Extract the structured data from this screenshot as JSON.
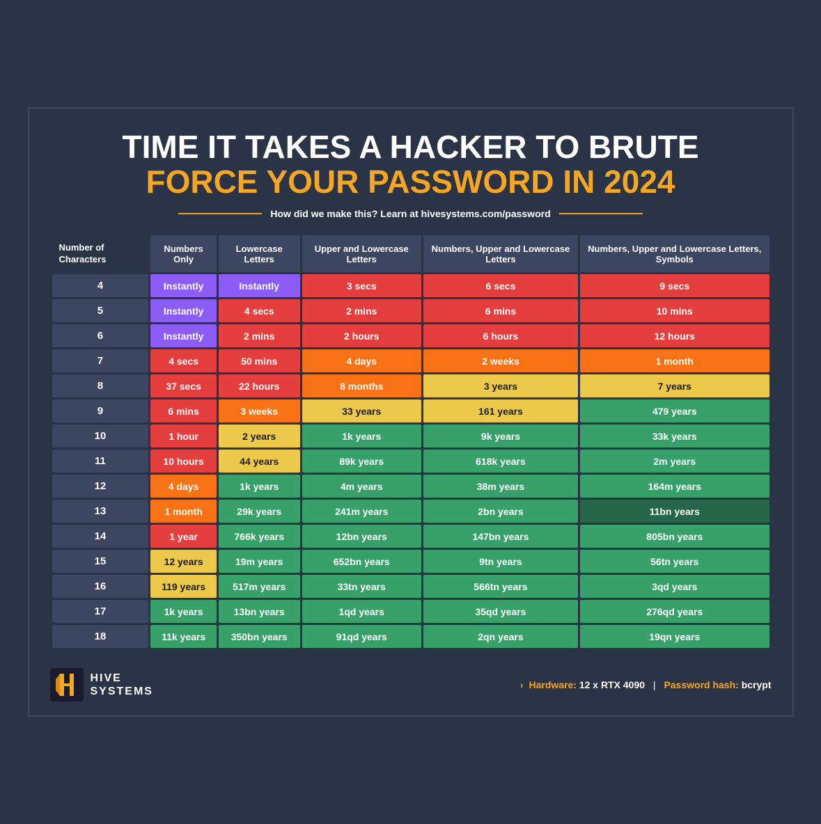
{
  "title": {
    "line1": "TIME IT TAKES A HACKER TO BRUTE",
    "line2": "FORCE YOUR PASSWORD IN ",
    "year": "2024"
  },
  "subtitle": "How did we make this? Learn at hivesystems.com/password",
  "headers": {
    "col0": "Number of Characters",
    "col1": "Numbers Only",
    "col2": "Lowercase Letters",
    "col3": "Upper and Lowercase Letters",
    "col4": "Numbers, Upper and Lowercase Letters",
    "col5": "Numbers, Upper and Lowercase Letters, Symbols"
  },
  "rows": [
    {
      "chars": "4",
      "c1": "Instantly",
      "c2": "Instantly",
      "c3": "3 secs",
      "c4": "6 secs",
      "c5": "9 secs",
      "cl1": "instantly",
      "cl2": "instantly",
      "cl3": "red",
      "cl4": "red",
      "cl5": "red"
    },
    {
      "chars": "5",
      "c1": "Instantly",
      "c2": "4 secs",
      "c3": "2 mins",
      "c4": "6 mins",
      "c5": "10 mins",
      "cl1": "instantly",
      "cl2": "red",
      "cl3": "red",
      "cl4": "red",
      "cl5": "red"
    },
    {
      "chars": "6",
      "c1": "Instantly",
      "c2": "2 mins",
      "c3": "2 hours",
      "c4": "6 hours",
      "c5": "12 hours",
      "cl1": "instantly",
      "cl2": "red",
      "cl3": "red",
      "cl4": "red",
      "cl5": "red"
    },
    {
      "chars": "7",
      "c1": "4 secs",
      "c2": "50 mins",
      "c3": "4 days",
      "c4": "2 weeks",
      "c5": "1 month",
      "cl1": "red",
      "cl2": "red",
      "cl3": "orange",
      "cl4": "orange",
      "cl5": "orange"
    },
    {
      "chars": "8",
      "c1": "37 secs",
      "c2": "22 hours",
      "c3": "8 months",
      "c4": "3 years",
      "c5": "7 years",
      "cl1": "red",
      "cl2": "red",
      "cl3": "orange",
      "cl4": "yellow",
      "cl5": "yellow"
    },
    {
      "chars": "9",
      "c1": "6 mins",
      "c2": "3 weeks",
      "c3": "33 years",
      "c4": "161 years",
      "c5": "479 years",
      "cl1": "red",
      "cl2": "orange",
      "cl3": "yellow",
      "cl4": "yellow",
      "cl5": "green"
    },
    {
      "chars": "10",
      "c1": "1 hour",
      "c2": "2 years",
      "c3": "1k years",
      "c4": "9k years",
      "c5": "33k years",
      "cl1": "red",
      "cl2": "yellow",
      "cl3": "green",
      "cl4": "green",
      "cl5": "green"
    },
    {
      "chars": "11",
      "c1": "10 hours",
      "c2": "44 years",
      "c3": "89k years",
      "c4": "618k years",
      "c5": "2m years",
      "cl1": "red",
      "cl2": "yellow",
      "cl3": "green",
      "cl4": "green",
      "cl5": "green"
    },
    {
      "chars": "12",
      "c1": "4 days",
      "c2": "1k years",
      "c3": "4m years",
      "c4": "38m years",
      "c5": "164m years",
      "cl1": "orange",
      "cl2": "green",
      "cl3": "green",
      "cl4": "green",
      "cl5": "green"
    },
    {
      "chars": "13",
      "c1": "1 month",
      "c2": "29k years",
      "c3": "241m years",
      "c4": "2bn years",
      "c5": "11bn years",
      "cl1": "orange",
      "cl2": "green",
      "cl3": "green",
      "cl4": "green",
      "cl5": "dark-green"
    },
    {
      "chars": "14",
      "c1": "1 year",
      "c2": "766k years",
      "c3": "12bn years",
      "c4": "147bn years",
      "c5": "805bn years",
      "cl1": "red",
      "cl2": "green",
      "cl3": "green",
      "cl4": "green",
      "cl5": "green"
    },
    {
      "chars": "15",
      "c1": "12 years",
      "c2": "19m years",
      "c3": "652bn years",
      "c4": "9tn years",
      "c5": "56tn years",
      "cl1": "yellow",
      "cl2": "green",
      "cl3": "green",
      "cl4": "green",
      "cl5": "green"
    },
    {
      "chars": "16",
      "c1": "119 years",
      "c2": "517m years",
      "c3": "33tn years",
      "c4": "566tn years",
      "c5": "3qd years",
      "cl1": "yellow",
      "cl2": "green",
      "cl3": "green",
      "cl4": "green",
      "cl5": "green"
    },
    {
      "chars": "17",
      "c1": "1k years",
      "c2": "13bn years",
      "c3": "1qd years",
      "c4": "35qd years",
      "c5": "276qd years",
      "cl1": "green",
      "cl2": "green",
      "cl3": "green",
      "cl4": "green",
      "cl5": "green"
    },
    {
      "chars": "18",
      "c1": "11k years",
      "c2": "350bn years",
      "c3": "91qd years",
      "c4": "2qn years",
      "c5": "19qn years",
      "cl1": "green",
      "cl2": "green",
      "cl3": "green",
      "cl4": "green",
      "cl5": "green"
    }
  ],
  "footer": {
    "hardware_label": "Hardware:",
    "hardware_value": "12 x RTX 4090",
    "hash_label": "Password hash:",
    "hash_value": "bcrypt",
    "logo_name": "HIVE\nSYSTEMS",
    "arrow": "›"
  }
}
